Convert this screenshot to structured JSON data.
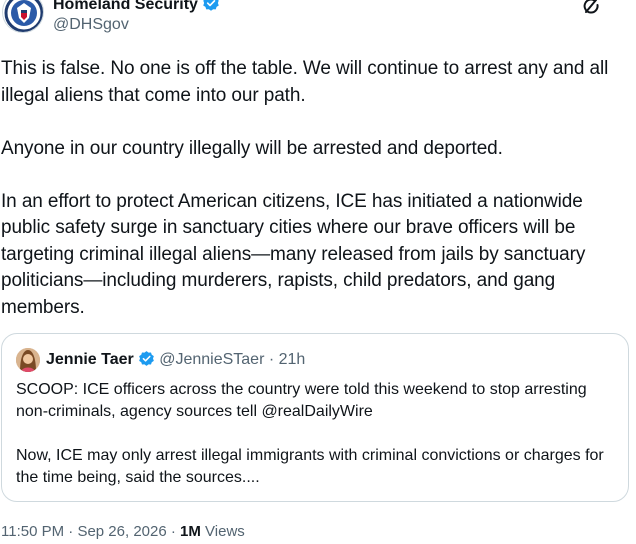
{
  "author": {
    "name": "Homeland Security",
    "handle": "@DHSgov"
  },
  "post": {
    "paragraphs": [
      "This is false. No one is off the table. We will continue to arrest any and all illegal aliens that come into our path.",
      "Anyone in our country illegally will be arrested and deported.",
      "In an effort to protect American citizens, ICE has initiated a nationwide public safety surge in sanctuary cities where our brave officers will be targeting criminal illegal aliens—many released from jails by sanctuary politicians—including murderers, rapists, child predators, and gang members."
    ]
  },
  "quote": {
    "name": "Jennie Taer",
    "handle": "@JennieSTaer",
    "separator": "·",
    "time": "21h",
    "paragraphs": [
      "SCOOP: ICE officers across the country were told this weekend to stop arresting non-criminals, agency sources tell @realDailyWire",
      "Now,  ICE may only arrest illegal immigrants with criminal convictions or charges for the time being, said the sources...."
    ]
  },
  "meta": {
    "time": "11:50 PM",
    "separator": "·",
    "date": "Sep 26, 2026",
    "views_count": "1M",
    "views_label": "Views"
  },
  "colors": {
    "verified_blue": "#1d9bf0",
    "text": "#0f1419",
    "secondary": "#536471",
    "border": "#cfd9de"
  },
  "icons": [
    "dhs-seal-icon",
    "verified-badge-icon",
    "grok-icon"
  ]
}
